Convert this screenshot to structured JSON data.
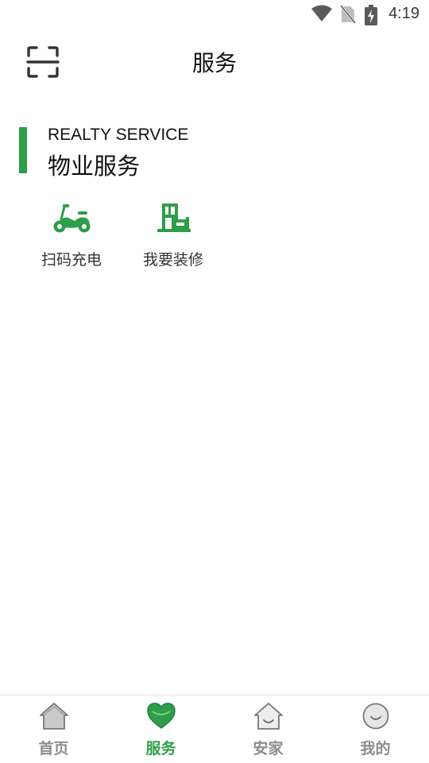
{
  "status_bar": {
    "time": "4:19",
    "icons": [
      "wifi-icon",
      "no-sim-icon",
      "battery-charging-icon"
    ]
  },
  "header": {
    "title": "服务",
    "scan_icon": "scan-icon"
  },
  "section": {
    "title_en": "REALTY SERVICE",
    "title_cn": "物业服务",
    "accent_color": "#2e9e48",
    "items": [
      {
        "label": "扫码充电",
        "icon": "scooter-icon"
      },
      {
        "label": "我要装修",
        "icon": "renovation-icon"
      }
    ]
  },
  "bottom_nav": {
    "active_color": "#2e9e48",
    "inactive_color": "#8c8c8c",
    "items": [
      {
        "label": "首页",
        "icon": "home-icon",
        "active": false
      },
      {
        "label": "服务",
        "icon": "heart-icon",
        "active": true
      },
      {
        "label": "安家",
        "icon": "house-smile-icon",
        "active": false
      },
      {
        "label": "我的",
        "icon": "profile-face-icon",
        "active": false
      }
    ]
  }
}
